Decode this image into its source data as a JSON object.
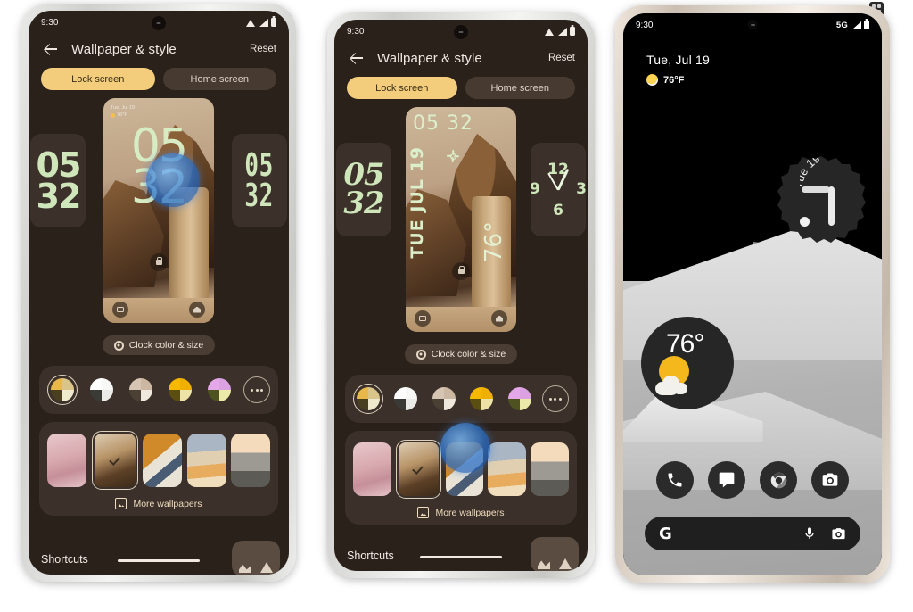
{
  "meta": {
    "corner_icon": "grid-icon"
  },
  "phone1": {
    "status": {
      "time": "9:30",
      "wifi": "wifi-icon",
      "signal": "signal-icon",
      "battery": "battery-icon"
    },
    "header": {
      "back": "back-arrow-icon",
      "title": "Wallpaper & style",
      "reset": "Reset"
    },
    "tabs": [
      {
        "label": "Lock screen",
        "active": true
      },
      {
        "label": "Home screen",
        "active": false
      }
    ],
    "clock_carousel": {
      "left": {
        "style": "bold-condensed",
        "hours": "05",
        "minutes": "32"
      },
      "center": {
        "style": "default",
        "hours": "05",
        "minutes": "32",
        "mini_date": "Tue, Jul 19",
        "mini_temp": "76°F"
      },
      "right": {
        "style": "narrow-display",
        "hours": "05",
        "minutes": "32"
      }
    },
    "clock_settings_chip": {
      "icon": "gear-icon",
      "label": "Clock color & size"
    },
    "color_swatches": {
      "selected_index": 0,
      "items": [
        {
          "name": "swatch-tan",
          "colors": [
            "#e8b84b",
            "#d9c489",
            "#4a4020",
            "#efe9cd"
          ]
        },
        {
          "name": "swatch-white",
          "colors": [
            "#ffffff",
            "#f7f7f5",
            "#3a3a36",
            "#ebebe7"
          ]
        },
        {
          "name": "swatch-beige",
          "colors": [
            "#d6c5b3",
            "#cbb7a2",
            "#4b4034",
            "#f0e8dc"
          ]
        },
        {
          "name": "swatch-yellow",
          "colors": [
            "#f7b900",
            "#f0b000",
            "#5a4e10",
            "#eee3a6"
          ]
        },
        {
          "name": "swatch-lilac",
          "colors": [
            "#e4a8e8",
            "#dba1e0",
            "#4d5220",
            "#eceaa8"
          ]
        }
      ],
      "more": {
        "name": "more-colors-button",
        "glyph": "ellipsis-icon"
      }
    },
    "wallpapers": {
      "selected_index": 1,
      "items": [
        {
          "name": "wallpaper-pink-dunes"
        },
        {
          "name": "wallpaper-rock-still-life"
        },
        {
          "name": "wallpaper-abstract-shapes"
        },
        {
          "name": "wallpaper-desert-dunes"
        },
        {
          "name": "wallpaper-city-skyline"
        }
      ],
      "more_label": "More wallpapers",
      "more_icon": "image-frame-icon"
    },
    "shortcuts": {
      "label": "Shortcuts"
    }
  },
  "phone2": {
    "status": {
      "time": "9:30"
    },
    "header": {
      "title": "Wallpaper & style",
      "reset": "Reset"
    },
    "tabs": [
      {
        "label": "Lock screen",
        "active": true
      },
      {
        "label": "Home screen",
        "active": false
      }
    ],
    "clock_carousel": {
      "left": {
        "style": "handwriting",
        "hours": "05",
        "minutes": "32"
      },
      "center": {
        "style": "vertical-date",
        "time": "05 32",
        "date": "TUE JUL 19",
        "temp": "76°"
      },
      "right": {
        "style": "analog",
        "marks": [
          "12",
          "3",
          "6",
          "9"
        ]
      }
    },
    "clock_settings_chip": {
      "icon": "gear-icon",
      "label": "Clock color & size"
    },
    "color_swatches": {
      "selected_index": 0
    },
    "wallpapers": {
      "selected_index": 1,
      "more_label": "More wallpapers"
    },
    "shortcuts": {
      "label": "Shortcuts"
    }
  },
  "phone3": {
    "status": {
      "time": "9:30",
      "network": "5G",
      "signal": "signal-icon",
      "battery": "battery-icon"
    },
    "home": {
      "date": "Tue, Jul 19",
      "temperature": "76°F",
      "weather_icon": "sun-icon",
      "clock_widget": {
        "name": "analog-clock-widget",
        "curved_label": "Tue 19"
      },
      "weather_widget": {
        "name": "weather-widget",
        "temperature": "76°",
        "icon": "sun-cloud-icon"
      },
      "dock": [
        {
          "name": "phone-app-icon",
          "label": "Phone"
        },
        {
          "name": "messages-app-icon",
          "label": "Messages"
        },
        {
          "name": "chrome-app-icon",
          "label": "Chrome"
        },
        {
          "name": "camera-app-icon",
          "label": "Camera"
        }
      ],
      "search": {
        "logo": "G",
        "mic": "microphone-icon",
        "lens": "lens-icon"
      }
    }
  },
  "colors": {
    "accent": "#f3cd7c",
    "panel": "#3b302a",
    "screen_bg": "#2a211b",
    "clock_green": "#cfe6bb",
    "touch_blue": "#2f73c8"
  }
}
